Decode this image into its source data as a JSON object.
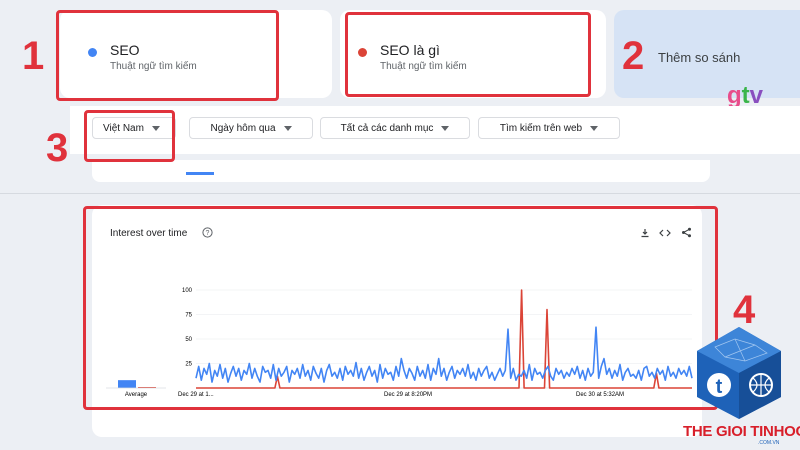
{
  "terms": [
    {
      "name": "SEO",
      "subtitle": "Thuật ngữ tìm kiếm",
      "color": "#4285f4"
    },
    {
      "name": "SEO là gì",
      "subtitle": "Thuật ngữ tìm kiếm",
      "color": "#db4437"
    }
  ],
  "compare_label": "Thêm so sánh",
  "filters": {
    "region": "Việt Nam",
    "time": "Ngày hôm qua",
    "category": "Tất cả các danh mục",
    "type": "Tìm kiếm trên web"
  },
  "steps": [
    "1",
    "2",
    "3",
    "4"
  ],
  "chart_section": {
    "title": "Interest over time",
    "help_icon": "help-circle-icon",
    "icons": [
      "download-icon",
      "embed-icon",
      "share-icon"
    ]
  },
  "watermark": {
    "logo_text": "gtv",
    "brand": "THE GIOI TINHOC",
    "domain": ".COM.VN"
  },
  "chart_data": {
    "type": "line",
    "y_ticks": [
      "100",
      "75",
      "50",
      "25"
    ],
    "ylim": [
      0,
      100
    ],
    "x_tick_labels": [
      "Dec 29 at 1...",
      "Dec 29 at 8:20PM",
      "Dec 30 at 5:32AM"
    ],
    "average_label": "Average",
    "averages": [
      {
        "name": "SEO",
        "value": 20
      },
      {
        "name": "SEO là gì",
        "value": 2
      }
    ],
    "series": [
      {
        "name": "SEO",
        "color": "#4285f4",
        "values": [
          10,
          22,
          8,
          20,
          14,
          25,
          6,
          18,
          12,
          24,
          10,
          20,
          6,
          15,
          22,
          12,
          20,
          8,
          18,
          14,
          25,
          10,
          20,
          12,
          6,
          22,
          16,
          18,
          10,
          24,
          8,
          20,
          12,
          16,
          22,
          6,
          18,
          14,
          20,
          10,
          24,
          12,
          18,
          8,
          22,
          15,
          10,
          20,
          6,
          18,
          24,
          12,
          16,
          10,
          20,
          8,
          22,
          14,
          18,
          12,
          26,
          10,
          20,
          8,
          16,
          22,
          12,
          18,
          6,
          24,
          10,
          20,
          14,
          16,
          8,
          22,
          12,
          30,
          18,
          10,
          20,
          15,
          8,
          22,
          12,
          18,
          10,
          24,
          8,
          20,
          14,
          30,
          12,
          20,
          8,
          16,
          22,
          10,
          18,
          14,
          20,
          12,
          24,
          10,
          16,
          8,
          20,
          12,
          18,
          22,
          10,
          16,
          8,
          14,
          20,
          12,
          18,
          60,
          10,
          20,
          8,
          14,
          12,
          18,
          10,
          24,
          8,
          20,
          14,
          16,
          10,
          18,
          22,
          12,
          8,
          20,
          14,
          18,
          10,
          16,
          12,
          20,
          14,
          22,
          10,
          18,
          8,
          20,
          12,
          16,
          62,
          10,
          22,
          30,
          14,
          20,
          10,
          18,
          12,
          24,
          8,
          16,
          20,
          12,
          14,
          10,
          18,
          8,
          20,
          22,
          12,
          16,
          10,
          20,
          14,
          18,
          8,
          22,
          12,
          16,
          10,
          20,
          14,
          18,
          12,
          22,
          10
        ]
      },
      {
        "name": "SEO là gì",
        "color": "#db4437",
        "values": [
          0,
          0,
          0,
          0,
          0,
          0,
          0,
          0,
          0,
          0,
          0,
          0,
          0,
          0,
          0,
          0,
          0,
          0,
          0,
          0,
          0,
          0,
          0,
          0,
          0,
          0,
          0,
          0,
          0,
          0,
          0,
          0,
          12,
          0,
          0,
          0,
          0,
          0,
          0,
          0,
          0,
          0,
          0,
          0,
          0,
          0,
          0,
          0,
          0,
          0,
          0,
          0,
          0,
          0,
          0,
          0,
          0,
          0,
          0,
          0,
          0,
          0,
          0,
          0,
          0,
          0,
          0,
          0,
          0,
          0,
          0,
          0,
          0,
          0,
          0,
          0,
          0,
          0,
          0,
          0,
          0,
          0,
          0,
          0,
          0,
          0,
          0,
          0,
          0,
          0,
          0,
          0,
          0,
          0,
          0,
          0,
          0,
          0,
          0,
          0,
          0,
          0,
          0,
          0,
          0,
          0,
          0,
          0,
          0,
          0,
          0,
          0,
          0,
          0,
          0,
          0,
          0,
          0,
          0,
          0,
          0,
          0,
          0,
          0,
          0,
          0,
          0,
          0,
          100,
          0,
          0,
          0,
          0,
          0,
          0,
          0,
          0,
          0,
          80,
          0,
          0,
          0,
          0,
          0,
          0,
          0,
          0,
          0,
          0,
          0,
          0,
          0,
          0,
          0,
          0,
          0,
          0,
          0,
          0,
          0,
          0,
          0,
          0,
          0,
          0,
          0,
          0,
          0,
          0,
          0,
          0,
          0,
          0,
          0,
          0,
          0,
          0,
          0,
          0,
          0,
          0,
          15,
          0,
          0,
          0,
          0,
          0,
          0,
          0,
          0,
          0,
          0,
          0,
          0,
          0,
          0
        ]
      }
    ]
  }
}
